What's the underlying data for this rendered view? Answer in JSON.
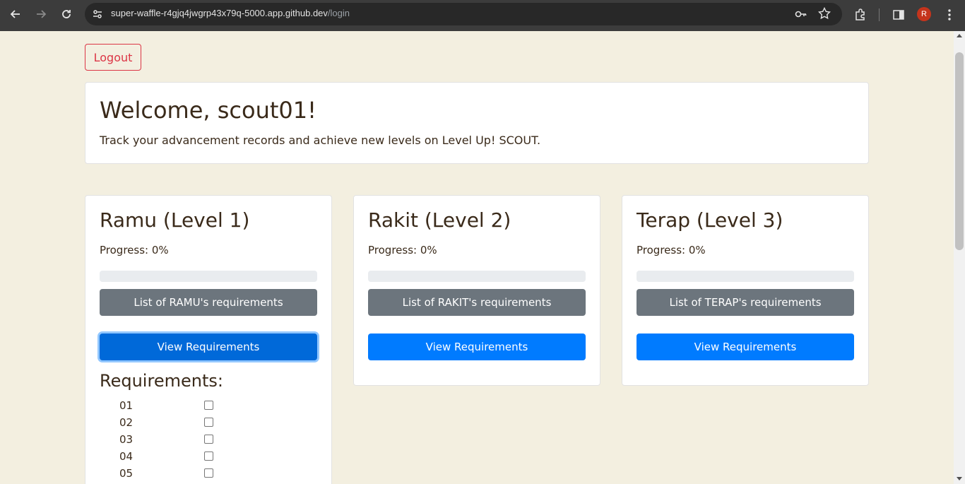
{
  "browser": {
    "url_host": "super-waffle-r4gjq4jwgrp43x79q-5000.app.github.dev",
    "url_path": "/login",
    "avatar_initial": "R"
  },
  "page": {
    "logout_label": "Logout",
    "welcome_title": "Welcome, scout01!",
    "welcome_subtitle": "Track your advancement records and achieve new levels on Level Up! SCOUT."
  },
  "levels": [
    {
      "title": "Ramu (Level 1)",
      "progress_text": "Progress: 0%",
      "progress_value": 0,
      "list_label": "List of RAMU's requirements",
      "view_label": "View Requirements",
      "requirements_heading": "Requirements:",
      "requirements": [
        "01",
        "02",
        "03",
        "04",
        "05"
      ]
    },
    {
      "title": "Rakit (Level 2)",
      "progress_text": "Progress: 0%",
      "progress_value": 0,
      "list_label": "List of RAKIT's requirements",
      "view_label": "View Requirements"
    },
    {
      "title": "Terap (Level 3)",
      "progress_text": "Progress: 0%",
      "progress_value": 0,
      "list_label": "List of TERAP's requirements",
      "view_label": "View Requirements"
    }
  ],
  "colors": {
    "background": "#f3efe0",
    "primary": "#007bff",
    "secondary": "#6c757d",
    "danger": "#dc3545"
  }
}
